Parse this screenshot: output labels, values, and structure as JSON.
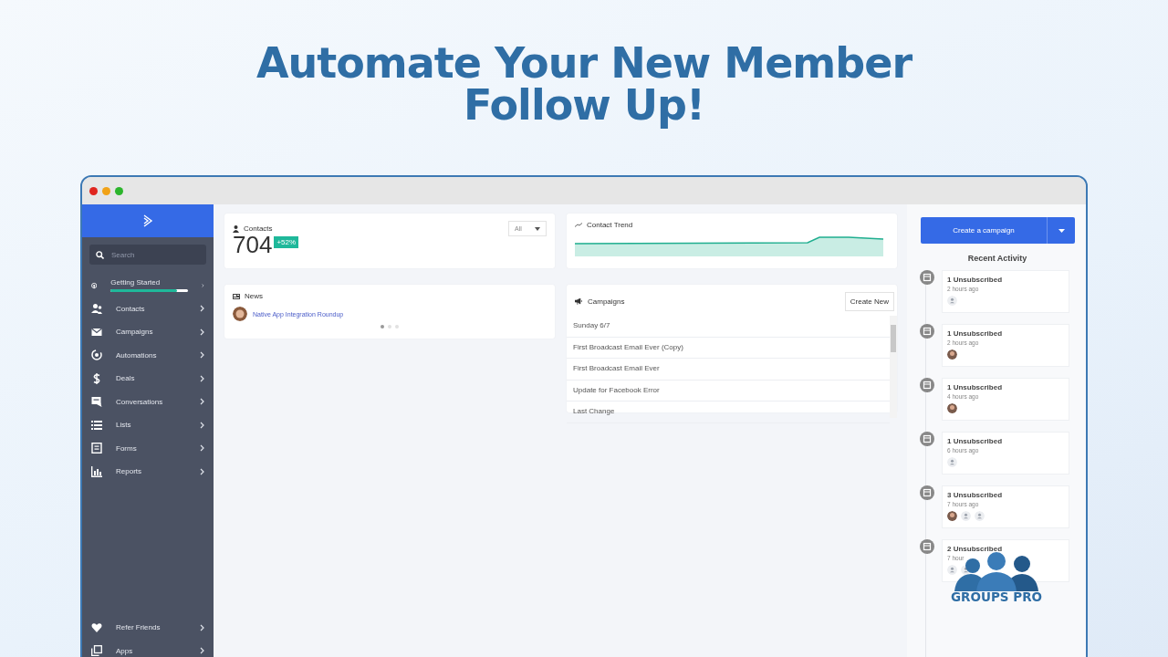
{
  "headline": "Automate Your New Member Follow Up!",
  "sidebar": {
    "search": {
      "placeholder": "Search"
    },
    "items": [
      {
        "label": "Getting Started",
        "level": 0.85
      },
      {
        "label": "Contacts"
      },
      {
        "label": "Campaigns"
      },
      {
        "label": "Automations"
      },
      {
        "label": "Deals"
      },
      {
        "label": "Conversations"
      },
      {
        "label": "Lists"
      },
      {
        "label": "Forms"
      },
      {
        "label": "Reports"
      }
    ],
    "footer_items": [
      {
        "label": "Refer Friends"
      },
      {
        "label": "Apps"
      }
    ]
  },
  "contacts": {
    "title": "Contacts",
    "count": "704",
    "change": "+52%",
    "filter": "All"
  },
  "news": {
    "title": "News",
    "item": "Native App Integration Roundup",
    "pages": [
      {
        "selected": true
      },
      {
        "selected": false
      },
      {
        "selected": false
      }
    ]
  },
  "contact_trend": {
    "title": "Contact Trend"
  },
  "campaigns": {
    "title": "Campaigns",
    "button": "Create New",
    "rows": [
      "Sunday 6/7",
      "First Broadcast Email Ever (Copy)",
      "First Broadcast Email Ever",
      "Update for Facebook Error",
      "Last Change"
    ]
  },
  "create_button": "Create a campaign",
  "recent_activity": {
    "title": "Recent Activity",
    "items": [
      {
        "title": "1 Unsubscribed",
        "time": "2 hours ago",
        "avatars": [
          {
            "kind": "placeholder"
          }
        ]
      },
      {
        "title": "1 Unsubscribed",
        "time": "2 hours ago",
        "avatars": [
          {
            "kind": "photo"
          }
        ]
      },
      {
        "title": "1 Unsubscribed",
        "time": "4 hours ago",
        "avatars": [
          {
            "kind": "photo"
          }
        ]
      },
      {
        "title": "1 Unsubscribed",
        "time": "6 hours ago",
        "avatars": [
          {
            "kind": "placeholder"
          }
        ]
      },
      {
        "title": "3 Unsubscribed",
        "time": "7 hours ago",
        "avatars": [
          {
            "kind": "photo"
          },
          {
            "kind": "placeholder"
          },
          {
            "kind": "placeholder"
          }
        ]
      },
      {
        "title": "2 Unsubscribed",
        "time": "7 hour",
        "avatars": [
          {
            "kind": "placeholder"
          },
          {
            "kind": "placeholder"
          }
        ]
      }
    ]
  },
  "logo": "GROUPS PRO"
}
